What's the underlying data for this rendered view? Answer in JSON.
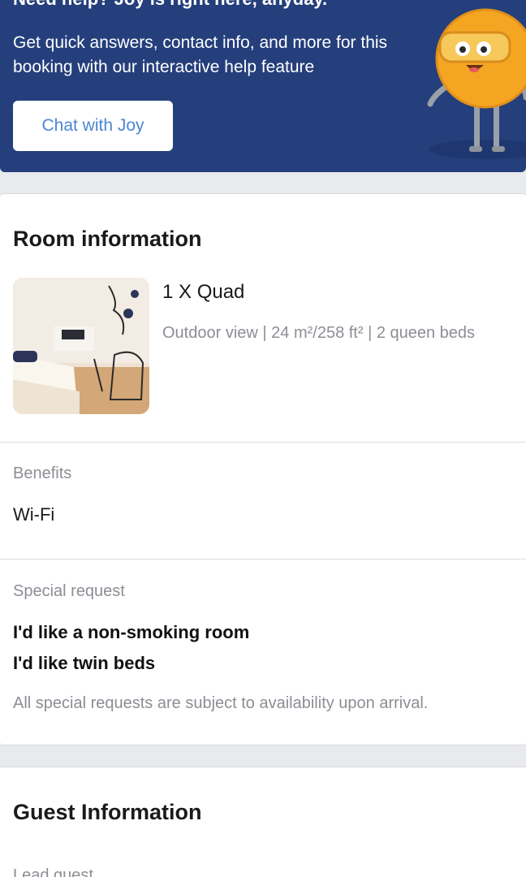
{
  "help_banner": {
    "heading": "Need help? Joy is right here, anyday.",
    "description": "Get quick answers, contact info, and more for this booking with our interactive help feature",
    "chat_button_label": "Chat with Joy",
    "mascot_icon": "joy-mascot-icon"
  },
  "room_info": {
    "title": "Room information",
    "room_name": "1 X Quad",
    "room_details": "Outdoor view | 24 m²/258 ft² | 2 queen beds",
    "benefits_label": "Benefits",
    "benefits": [
      "Wi-Fi"
    ],
    "special_request_label": "Special request",
    "special_requests": [
      "I'd like a non-smoking room",
      "I'd like twin beds"
    ],
    "special_request_note": "All special requests are subject to availability upon arrival."
  },
  "guest_info": {
    "title": "Guest Information",
    "lead_guest_label": "Lead guest"
  },
  "colors": {
    "banner_bg": "#243f7b",
    "button_text": "#4b86d6",
    "muted_text": "#8b8e94",
    "page_bg": "#e9eaee"
  }
}
